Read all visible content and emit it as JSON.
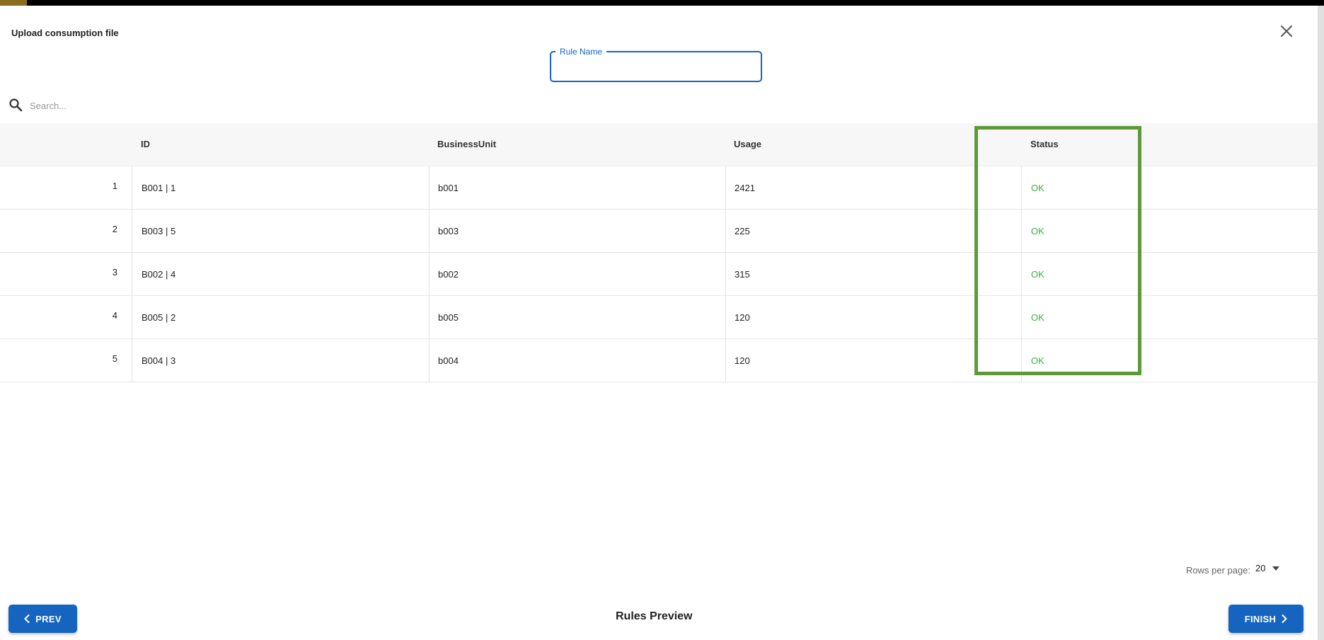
{
  "modal": {
    "title": "Upload consumption file",
    "close_icon": "close-icon"
  },
  "rule_name": {
    "label": "Rule Name",
    "value": ""
  },
  "search": {
    "icon": "search-icon",
    "placeholder": "Search..."
  },
  "table": {
    "columns": [
      "ID",
      "BusinessUnit",
      "Usage",
      "Status"
    ],
    "rows": [
      {
        "num": "1",
        "id": "B001 | 1",
        "business_unit": "b001",
        "usage": "2421",
        "status": "OK"
      },
      {
        "num": "2",
        "id": "B003 | 5",
        "business_unit": "b003",
        "usage": "225",
        "status": "OK"
      },
      {
        "num": "3",
        "id": "B002 | 4",
        "business_unit": "b002",
        "usage": "315",
        "status": "OK"
      },
      {
        "num": "4",
        "id": "B005 | 2",
        "business_unit": "b005",
        "usage": "120",
        "status": "OK"
      },
      {
        "num": "5",
        "id": "B004 | 3",
        "business_unit": "b004",
        "usage": "120",
        "status": "OK"
      }
    ],
    "status_color": "#3cb043",
    "highlight_color": "#5e9a3a"
  },
  "pagination": {
    "rows_per_page_label": "Rows per page:",
    "rows_per_page_value": "20"
  },
  "footer": {
    "title": "Rules Preview",
    "prev_label": "PREV",
    "finish_label": "FINISH"
  },
  "colors": {
    "primary": "#1565c0",
    "accent_bar": "#8a6d1e"
  }
}
